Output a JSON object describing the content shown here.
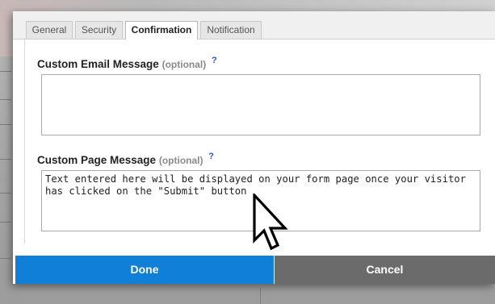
{
  "tabs": [
    {
      "label": "General",
      "active": false
    },
    {
      "label": "Security",
      "active": false
    },
    {
      "label": "Confirmation",
      "active": true
    },
    {
      "label": "Notification",
      "active": false
    }
  ],
  "email_section": {
    "label": "Custom Email Message",
    "optional": "(optional)",
    "help": "?",
    "value": ""
  },
  "page_section": {
    "label": "Custom Page Message",
    "optional": "(optional)",
    "help": "?",
    "value": "Text entered here will be displayed on your form page once your visitor\nhas clicked on the \"Submit\" button"
  },
  "footer": {
    "done_label": "Done",
    "cancel_label": "Cancel"
  },
  "colors": {
    "done": "#0f7fd8",
    "cancel": "#6b6b6b",
    "help": "#2a56c6"
  },
  "icons": {
    "pointer": "mouse-pointer-icon"
  }
}
